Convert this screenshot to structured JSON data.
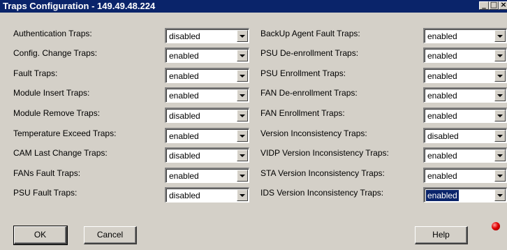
{
  "window": {
    "title": "Traps Configuration - 149.49.48.224"
  },
  "left_traps": [
    {
      "label": "Authentication Traps:",
      "value": "disabled"
    },
    {
      "label": "Config. Change Traps:",
      "value": "enabled"
    },
    {
      "label": "Fault Traps:",
      "value": "enabled"
    },
    {
      "label": "Module Insert Traps:",
      "value": "enabled"
    },
    {
      "label": "Module Remove Traps:",
      "value": "disabled"
    },
    {
      "label": "Temperature Exceed Traps:",
      "value": "enabled"
    },
    {
      "label": "CAM Last Change Traps:",
      "value": "disabled"
    },
    {
      "label": "FANs Fault Traps:",
      "value": "enabled"
    },
    {
      "label": "PSU Fault Traps:",
      "value": "disabled"
    }
  ],
  "right_traps": [
    {
      "label": "BackUp Agent Fault Traps:",
      "value": "enabled"
    },
    {
      "label": "PSU De-enrollment Traps:",
      "value": "enabled"
    },
    {
      "label": "PSU Enrollment Traps:",
      "value": "enabled"
    },
    {
      "label": "FAN De-enrollment Traps:",
      "value": "enabled"
    },
    {
      "label": "FAN Enrollment Traps:",
      "value": "enabled"
    },
    {
      "label": "Version Inconsistency Traps:",
      "value": "disabled"
    },
    {
      "label": "VIDP Version Inconsistency Traps:",
      "value": "enabled"
    },
    {
      "label": "STA Version Inconsistency Traps:",
      "value": "enabled"
    },
    {
      "label": "IDS Version Inconsistency Traps:",
      "value": "enabled",
      "focused": true
    }
  ],
  "buttons": {
    "ok": "OK",
    "cancel": "Cancel",
    "help": "Help"
  },
  "colors": {
    "titlebar": "#0a246a",
    "dialog_face": "#d4d0c8",
    "status_led": "#e00000"
  },
  "icons": {
    "minimize": "minimize-icon",
    "maximize": "maximize-icon",
    "close": "close-icon",
    "dropdown": "chevron-down-icon",
    "status": "status-led-icon"
  }
}
